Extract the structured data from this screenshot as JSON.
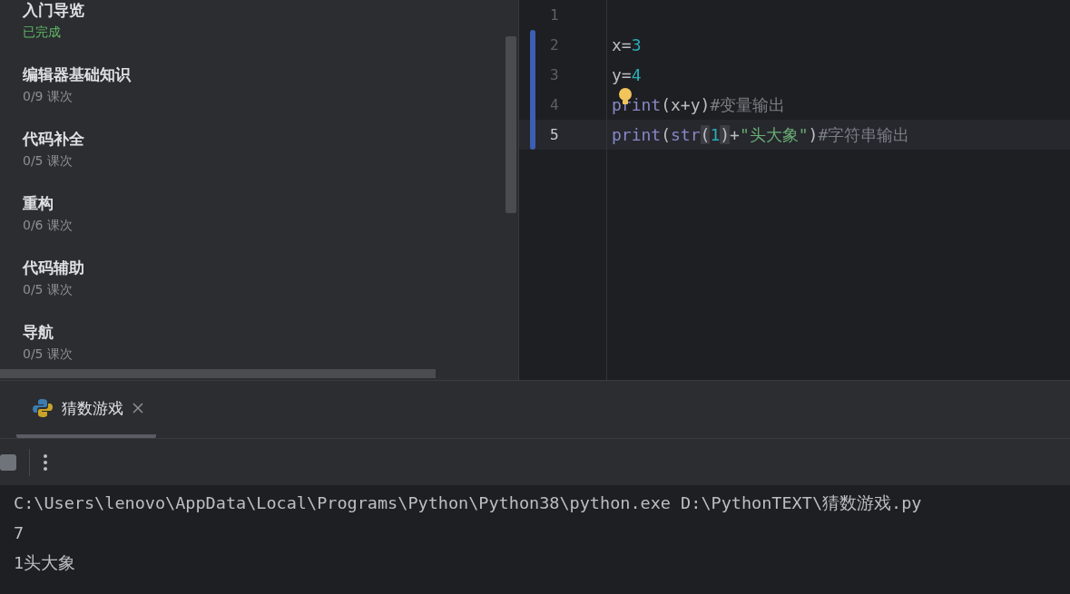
{
  "lessons": [
    {
      "title": "入门导览",
      "progress": "已完成",
      "done": true
    },
    {
      "title": "编辑器基础知识",
      "progress": "0/9 课次",
      "done": false
    },
    {
      "title": "代码补全",
      "progress": "0/5 课次",
      "done": false
    },
    {
      "title": "重构",
      "progress": "0/6 课次",
      "done": false
    },
    {
      "title": "代码辅助",
      "progress": "0/5 课次",
      "done": false
    },
    {
      "title": "导航",
      "progress": "0/5 课次",
      "done": false
    }
  ],
  "editor": {
    "lines": [
      {
        "number": "1",
        "changed": false,
        "selected": false
      },
      {
        "number": "2",
        "changed": true,
        "selected": false,
        "tokens": [
          {
            "kind": "plain",
            "text": "x="
          },
          {
            "kind": "number",
            "text": "3"
          }
        ]
      },
      {
        "number": "3",
        "changed": true,
        "selected": false,
        "tokens": [
          {
            "kind": "plain",
            "text": "y="
          },
          {
            "kind": "number",
            "text": "4"
          }
        ]
      },
      {
        "number": "4",
        "changed": true,
        "selected": false,
        "bulb": true,
        "tokens": [
          {
            "kind": "builtin",
            "text": "print"
          },
          {
            "kind": "plain",
            "text": "(x+y)"
          },
          {
            "kind": "comment",
            "text": "#变量输出"
          }
        ]
      },
      {
        "number": "5",
        "changed": true,
        "selected": true,
        "tokens": [
          {
            "kind": "builtin",
            "text": "print"
          },
          {
            "kind": "plain",
            "text": "("
          },
          {
            "kind": "builtin",
            "text": "str"
          },
          {
            "kind": "brace",
            "text": "("
          },
          {
            "kind": "number",
            "text": "1"
          },
          {
            "kind": "brace",
            "text": ")"
          },
          {
            "kind": "plain",
            "text": "+"
          },
          {
            "kind": "string",
            "text": "\"头大象\""
          },
          {
            "kind": "plain",
            "text": ")"
          },
          {
            "kind": "comment",
            "text": "#字符串输出"
          }
        ]
      }
    ]
  },
  "run_panel": {
    "tabs": [
      {
        "label": "猜数游戏",
        "selected": true,
        "closable": true
      }
    ],
    "output": [
      "C:\\Users\\lenovo\\AppData\\Local\\Programs\\Python\\Python38\\python.exe D:\\PythonTEXT\\猜数游戏.py",
      "7",
      "1头大象"
    ]
  }
}
